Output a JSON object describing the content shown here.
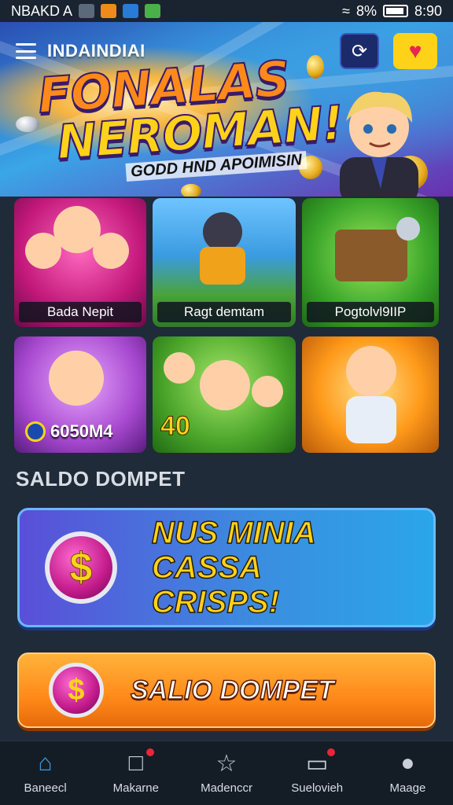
{
  "status_bar": {
    "carrier": "NBAKD A",
    "battery_text": "8%",
    "time": "8:90"
  },
  "header": {
    "app_title": "INDAINDIAI",
    "sync_icon": "sync-icon",
    "heart_icon": "heart-icon"
  },
  "hero": {
    "headline_line1": "FONALAS",
    "headline_line2": "NEROMAN!",
    "subline": "GODD HND APOIMISIN"
  },
  "games": [
    {
      "label": "Bada Nepit",
      "color": "#c2187a"
    },
    {
      "label": "Ragt demtam",
      "color": "#3a9be0"
    },
    {
      "label": "Pogtolvl9IIP",
      "color": "#3aa52a"
    },
    {
      "label": "",
      "amount": "6050M4",
      "color": "#a84ad0"
    },
    {
      "label": "",
      "number": "40",
      "color": "#4aa52a"
    },
    {
      "label": "",
      "color": "#ff9a1a"
    }
  ],
  "wallet": {
    "section_title": "SALDO DOMPET",
    "promo_line1": "NUS MINIA CASSA",
    "promo_line2": "CRISPS!",
    "coin_symbol": "$",
    "button_label": "SALIO DOMPET"
  },
  "bottom_nav": [
    {
      "label": "Baneecl",
      "icon": "home-icon",
      "active": true,
      "badge": false
    },
    {
      "label": "Makarne",
      "icon": "news-icon",
      "active": false,
      "badge": true
    },
    {
      "label": "Madenccr",
      "icon": "star-icon",
      "active": false,
      "badge": false
    },
    {
      "label": "Suelovieh",
      "icon": "inbox-icon",
      "active": false,
      "badge": true
    },
    {
      "label": "Maage",
      "icon": "profile-icon",
      "active": false,
      "badge": false
    }
  ]
}
